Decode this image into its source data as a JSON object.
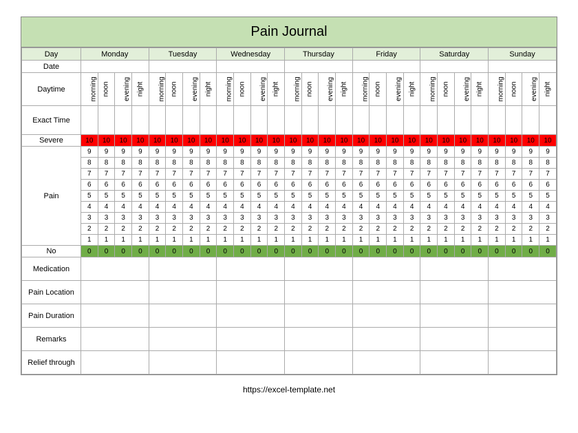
{
  "title": "Pain Journal",
  "headers": {
    "day": "Day",
    "days": [
      "Monday",
      "Tuesday",
      "Wednesday",
      "Thursday",
      "Friday",
      "Saturday",
      "Sunday"
    ]
  },
  "rowLabels": {
    "date": "Date",
    "daytime": "Daytime",
    "exactTime": "Exact Time",
    "severe": "Severe",
    "pain": "Pain",
    "no": "No",
    "medication": "Medication",
    "painLocation": "Pain Location",
    "painDuration": "Pain Duration",
    "remarks": "Remarks",
    "relief": "Relief through"
  },
  "timesOfDay": [
    "morning",
    "noon",
    "evening",
    "night"
  ],
  "scale": {
    "max": "10",
    "values": [
      "9",
      "8",
      "7",
      "6",
      "5",
      "4",
      "3",
      "2",
      "1"
    ],
    "min": "0"
  },
  "footer": "https://excel-template.net"
}
